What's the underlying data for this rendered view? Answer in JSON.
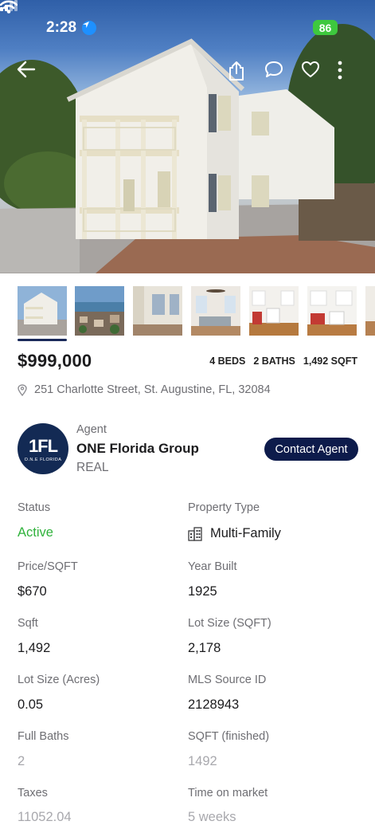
{
  "status_bar": {
    "time": "2:28",
    "battery": "86"
  },
  "listing": {
    "price": "$999,000",
    "beds": "4 BEDS",
    "baths": "2 BATHS",
    "sqft": "1,492 SQFT",
    "address": "251 Charlotte Street, St. Augustine, FL, 32084"
  },
  "agent": {
    "caption": "Agent",
    "name": "ONE Florida Group",
    "type": "REAL",
    "logo_text": "1FL",
    "logo_sub": "O.N.E FLORIDA",
    "contact_label": "Contact Agent"
  },
  "details": [
    {
      "label": "Status",
      "value": "Active"
    },
    {
      "label": "Property Type",
      "value": "Multi-Family"
    },
    {
      "label": "Price/SQFT",
      "value": "$670"
    },
    {
      "label": "Year Built",
      "value": "1925"
    },
    {
      "label": "Sqft",
      "value": "1,492"
    },
    {
      "label": "Lot Size (SQFT)",
      "value": "2,178"
    },
    {
      "label": "Lot Size (Acres)",
      "value": "0.05"
    },
    {
      "label": "MLS Source ID",
      "value": "2128943"
    },
    {
      "label": "Full Baths",
      "value": "2"
    },
    {
      "label": "SQFT (finished)",
      "value": "1492"
    },
    {
      "label": "Taxes",
      "value": "11052.04"
    },
    {
      "label": "Time on market",
      "value": "5 weeks"
    }
  ],
  "colors": {
    "accent": "#0d1b4b",
    "active": "#2fb23b",
    "muted": "#6e6e73"
  },
  "icons": [
    "back-arrow-icon",
    "share-icon",
    "comment-icon",
    "heart-icon",
    "more-icon",
    "location-pin-icon",
    "building-icon"
  ]
}
